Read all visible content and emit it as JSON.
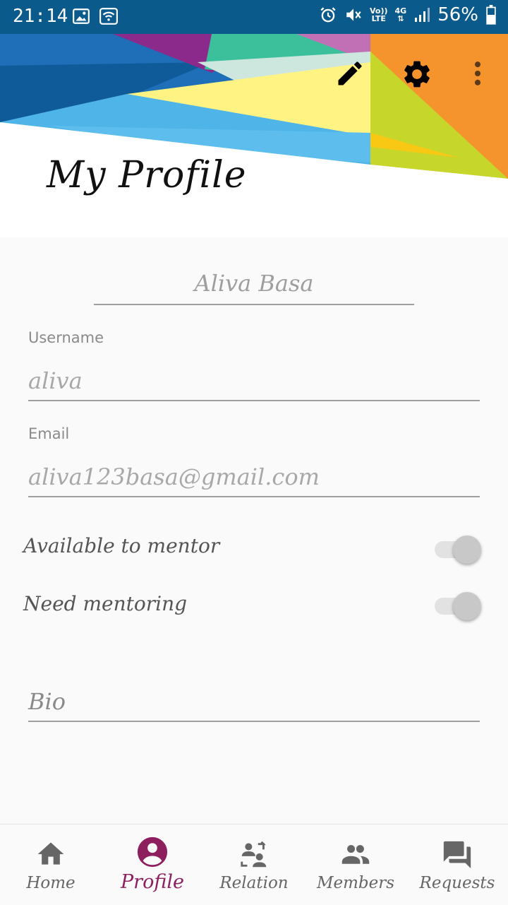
{
  "status_bar": {
    "time": "21:14",
    "volte_line1": "Vo))",
    "volte_line2": "LTE",
    "network_type": "4G",
    "battery": "56%",
    "icons": [
      "image-icon",
      "wifi-icon",
      "alarm-icon",
      "mute-icon",
      "signal-icon",
      "battery-icon"
    ]
  },
  "header": {
    "title": "My Profile",
    "actions": [
      {
        "name": "edit-icon"
      },
      {
        "name": "gear-icon"
      },
      {
        "name": "more-vert-icon"
      }
    ]
  },
  "profile": {
    "name": "Aliva Basa",
    "username_label": "Username",
    "username": "aliva",
    "email_label": "Email",
    "email": "aliva123basa@gmail.com",
    "available_to_mentor_label": "Available to mentor",
    "available_to_mentor": false,
    "need_mentoring_label": "Need mentoring",
    "need_mentoring": false,
    "bio_placeholder": "Bio"
  },
  "bottom_nav": {
    "items": [
      {
        "label": "Home",
        "icon": "home-icon",
        "active": false
      },
      {
        "label": "Profile",
        "icon": "account-circle-icon",
        "active": true
      },
      {
        "label": "Relation",
        "icon": "relation-icon",
        "active": false
      },
      {
        "label": "Members",
        "icon": "people-icon",
        "active": false
      },
      {
        "label": "Requests",
        "icon": "forum-icon",
        "active": false
      }
    ]
  },
  "colors": {
    "status_bar": "#0b5a8c",
    "accent": "#8e1f5f",
    "text_hint": "#9e9e9e",
    "background": "#fafafa"
  }
}
